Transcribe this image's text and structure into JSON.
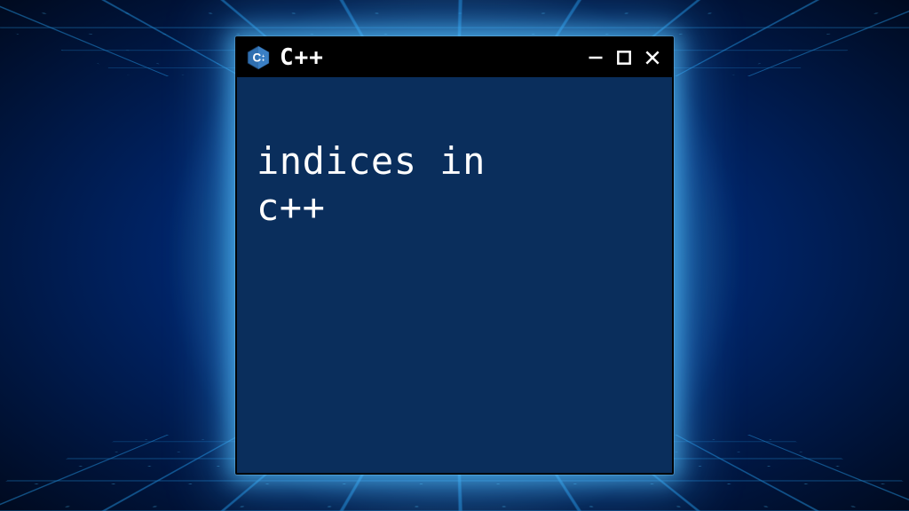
{
  "window": {
    "title": "C++",
    "icon": "cpp-logo-icon",
    "controls": {
      "minimize": "minimize-icon",
      "maximize": "maximize-icon",
      "close": "close-icon"
    }
  },
  "content": {
    "text": "indices in\nc++"
  },
  "colors": {
    "window_bg": "#0a2e5c",
    "titlebar_bg": "#000000",
    "text": "#ffffff",
    "glow": "#3fb4ff"
  }
}
